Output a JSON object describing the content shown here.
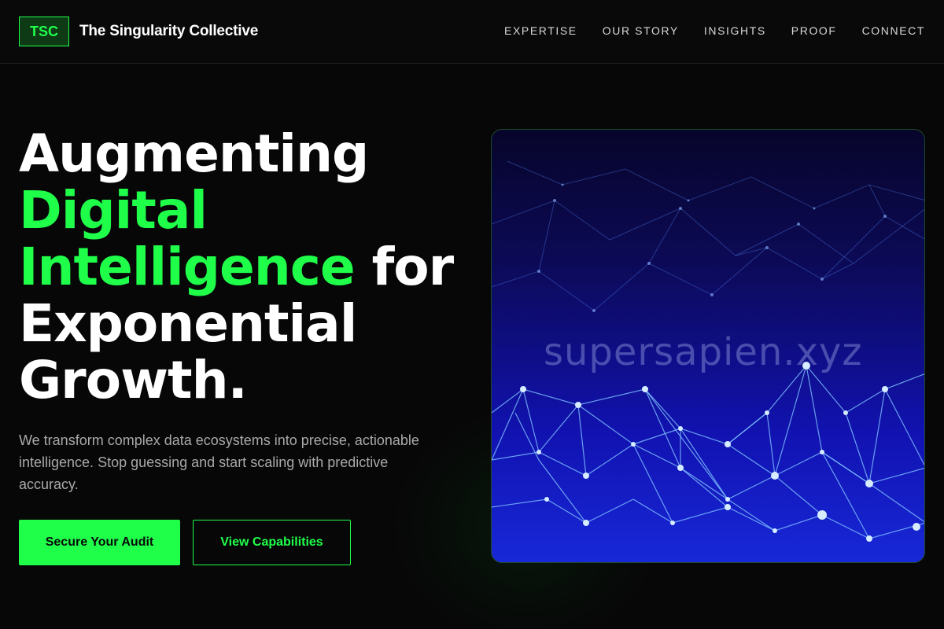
{
  "header": {
    "logo_text": "TSC",
    "brand_name": "The Singularity Collective",
    "nav": [
      "EXPERTISE",
      "OUR STORY",
      "INSIGHTS",
      "PROOF",
      "CONNECT"
    ]
  },
  "hero": {
    "headline_line1": "Augmenting",
    "headline_accent_1": "Digital",
    "headline_accent_2": "Intelligence",
    "headline_for": "for",
    "headline_line4": "Exponential",
    "headline_line5": "Growth.",
    "lede": "We transform complex data ecosystems into precise, actionable intelligence. Stop guessing and start scaling with predictive accuracy.",
    "primary_cta": "Secure Your Audit",
    "secondary_cta": "View Capabilities",
    "image_watermark": "supersapien.xyz"
  },
  "colors": {
    "accent": "#1fff4a",
    "background": "#070707",
    "text_muted": "#a9a9a9"
  }
}
